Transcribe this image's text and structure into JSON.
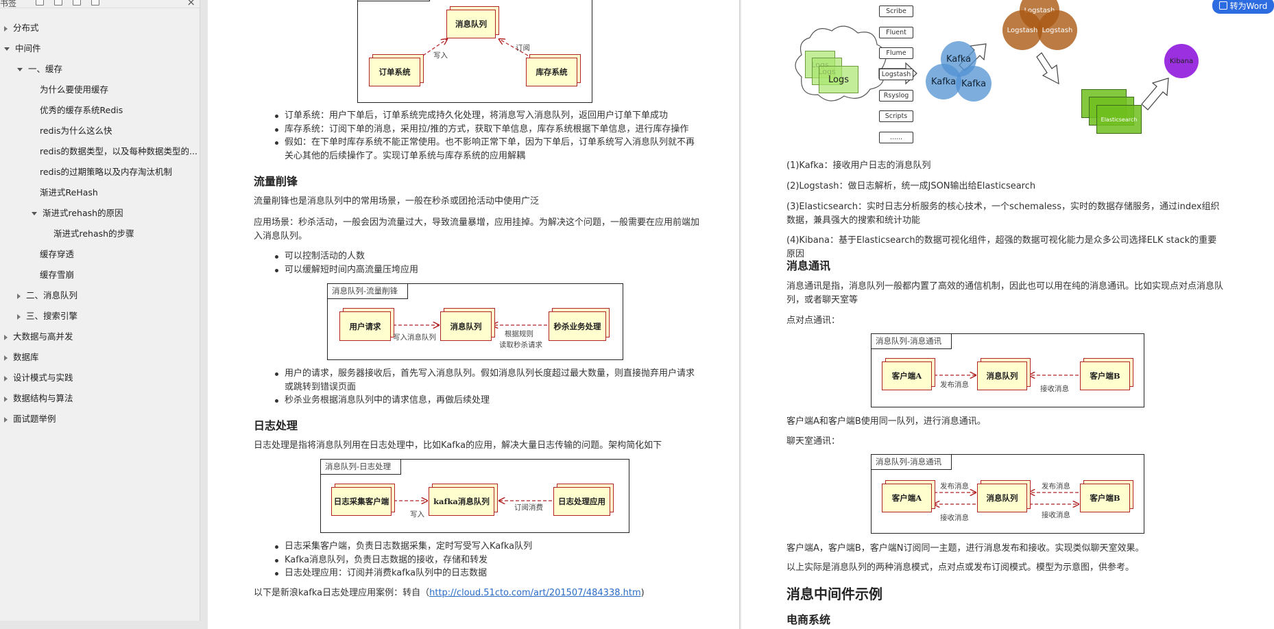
{
  "sidebar": {
    "title": "书签",
    "items": [
      {
        "label": "分布式",
        "state": "closed"
      },
      {
        "label": "中间件",
        "state": "open"
      },
      {
        "label": "一、缓存",
        "state": "open"
      },
      {
        "label": "为什么要使用缓存",
        "state": "none"
      },
      {
        "label": "优秀的缓存系统Redis",
        "state": "none"
      },
      {
        "label": "redis为什么这么快",
        "state": "none"
      },
      {
        "label": "redis的数据类型，以及每种数据类型的...",
        "state": "none"
      },
      {
        "label": "redis的过期策略以及内存淘汰机制",
        "state": "none"
      },
      {
        "label": "渐进式ReHash",
        "state": "none"
      },
      {
        "label": "渐进式rehash的原因",
        "state": "open"
      },
      {
        "label": "渐进式rehash的步骤",
        "state": "none"
      },
      {
        "label": "缓存穿透",
        "state": "none"
      },
      {
        "label": "缓存雪崩",
        "state": "none"
      },
      {
        "label": "二、消息队列",
        "state": "closed"
      },
      {
        "label": "三、搜索引擎",
        "state": "closed"
      },
      {
        "label": "大数据与高并发",
        "state": "closed"
      },
      {
        "label": "数据库",
        "state": "closed"
      },
      {
        "label": "设计模式与实践",
        "state": "closed"
      },
      {
        "label": "数据结构与算法",
        "state": "closed"
      },
      {
        "label": "面试题举例",
        "state": "closed"
      }
    ]
  },
  "toolbar": {
    "word_button": "转为Word"
  },
  "left_page": {
    "diagram1": {
      "queue": "消息队列",
      "order": "订单系统",
      "stock": "库存系统",
      "write": "写入",
      "subscribe": "订阅"
    },
    "bullets1": [
      "订单系统：用户下单后，订单系统完成持久化处理，将消息写入消息队列，返回用户订单下单成功",
      "库存系统：订阅下单的消息，采用拉/推的方式，获取下单信息，库存系统根据下单信息，进行库存操作",
      "假如：在下单时库存系统不能正常使用。也不影响正常下单，因为下单后，订单系统写入消息队列就不再关心其他的后续操作了。实现订单系统与库存系统的应用解耦"
    ],
    "h_peak": "流量削锋",
    "p_peak1": "流量削锋也是消息队列中的常用场景，一般在秒杀或团抢活动中使用广泛",
    "p_peak2": "应用场景：秒杀活动，一般会因为流量过大，导致流量暴增，应用挂掉。为解决这个问题，一般需要在应用前端加入消息队列。",
    "bullets2": [
      "可以控制活动的人数",
      "可以缓解短时间内高流量压垮应用"
    ],
    "diagram2": {
      "title": "消息队列-流量削锋",
      "user": "用户请求",
      "queue": "消息队列",
      "seckill": "秒杀业务处理",
      "write": "写入消息队列",
      "rule1": "根据规则",
      "rule2": "读取秒杀请求"
    },
    "bullets3": [
      "用户的请求，服务器接收后，首先写入消息队列。假如消息队列长度超过最大数量，则直接抛弃用户请求或跳转到错误页面",
      "秒杀业务根据消息队列中的请求信息，再做后续处理"
    ],
    "h_log": "日志处理",
    "p_log": "日志处理是指将消息队列用在日志处理中，比如Kafka的应用，解决大量日志传输的问题。架构简化如下",
    "diagram3": {
      "title": "消息队列-日志处理",
      "client": "日志采集客户端",
      "kafka": "kafka消息队列",
      "app": "日志处理应用",
      "write": "写入",
      "sub": "订阅消费"
    },
    "bullets4": [
      "日志采集客户端，负责日志数据采集，定时写受写入Kafka队列",
      "Kafka消息队列，负责日志数据的接收，存储和转发",
      "日志处理应用：订阅并消费kafka队列中的日志数据"
    ],
    "p_case_prefix": "以下是新浪kafka日志处理应用案例：转自（",
    "p_case_link": "http://cloud.51cto.com/art/201507/484338.htm",
    "p_case_suffix": ")"
  },
  "right_page": {
    "elk": {
      "sources": [
        "Scribe",
        "Fluent",
        "Flume",
        "Logstash",
        "Rsyslog",
        "Scripts",
        "......"
      ],
      "logs": [
        "Logs",
        "Logs",
        "Logs"
      ],
      "kafka": [
        "Kafka",
        "Kafka",
        "Kafka"
      ],
      "logstash": [
        "Logstash",
        "Logstash",
        "Logstash"
      ],
      "es": [
        "Elasticsearch"
      ],
      "kibana": "Kibana"
    },
    "p1": "(1)Kafka：接收用户日志的消息队列",
    "p2": "(2)Logstash：做日志解析，统一成JSON输出给Elasticsearch",
    "p3": "(3)Elasticsearch：实时日志分析服务的核心技术，一个schemaless，实时的数据存储服务，通过index组织数据，兼具强大的搜索和统计功能",
    "p4": "(4)Kibana：基于Elasticsearch的数据可视化组件，超强的数据可视化能力是众多公司选择ELK stack的重要原因",
    "h_msg": "消息通讯",
    "p_msg": "消息通讯是指，消息队列一般都内置了高效的通信机制，因此也可以用在纯的消息通讯。比如实现点对点消息队列，或者聊天室等",
    "p_p2p": "点对点通讯：",
    "diagram4": {
      "title": "消息队列-消息通讯",
      "a": "客户端A",
      "queue": "消息队列",
      "b": "客户端B",
      "pub": "发布消息",
      "recv": "接收消息"
    },
    "p_after4": "客户端A和客户端B使用同一队列，进行消息通讯。",
    "p_chat": "聊天室通讯：",
    "diagram5": {
      "title": "消息队列-消息通讯",
      "a": "客户端A",
      "queue": "消息队列",
      "b": "客户端B",
      "pub": "发布消息",
      "recv": "接收消息"
    },
    "p_after5": "客户端A，客户端B，客户端N订阅同一主题，进行消息发布和接收。实现类似聊天室效果。",
    "p_summary": "以上实际是消息队列的两种消息模式，点对点或发布订阅模式。模型为示意图，供参考。",
    "h_example": "消息中间件示例",
    "h_ecom": "电商系统"
  }
}
